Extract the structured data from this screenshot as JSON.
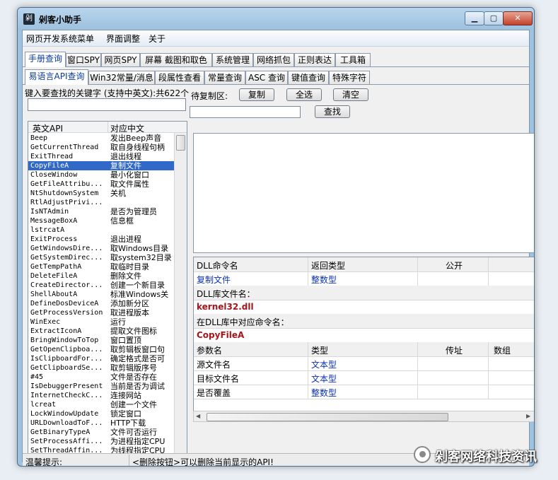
{
  "window": {
    "title": "剁客小助手",
    "min_glyph": "▁",
    "max_glyph": "▢",
    "close_glyph": "✕",
    "app_glyph": "剁"
  },
  "menu": [
    "网页开发系统菜单",
    "界面调整",
    "关于"
  ],
  "main_tabs": [
    {
      "label": "手册查询",
      "active": true
    },
    {
      "label": "窗口SPY",
      "active": false
    },
    {
      "label": "网页SPY",
      "active": false
    },
    {
      "label": "屏幕 截图和取色",
      "active": false
    },
    {
      "label": "系统管理",
      "active": false
    },
    {
      "label": "网络抓包",
      "active": false
    },
    {
      "label": "正则表达",
      "active": false
    },
    {
      "label": "工具箱",
      "active": false
    }
  ],
  "sub_tabs": [
    {
      "label": "易语言API查询",
      "active": true
    },
    {
      "label": "Win32常量/消息",
      "active": false
    },
    {
      "label": "段属性查看",
      "active": false
    },
    {
      "label": "常量查询",
      "active": false
    },
    {
      "label": "ASC 查询",
      "active": false
    },
    {
      "label": "键值查询",
      "active": false
    },
    {
      "label": "特殊字符",
      "active": false
    }
  ],
  "search": {
    "label": "键入要查找的关键字 (支持中英文):共622个",
    "value": ""
  },
  "copy_panel": {
    "label": "待复制区:",
    "copy_button": "复制",
    "select_all_button": "全选",
    "clear_button": "清空",
    "find_value": "",
    "find_button": "查找",
    "content": ""
  },
  "api_list": {
    "columns": [
      "英文API",
      "对应中文"
    ],
    "selected_index": 3,
    "rows": [
      [
        "Beep",
        "发出Beep声音"
      ],
      [
        "GetCurrentThread",
        "取自身线程句柄"
      ],
      [
        "ExitThread",
        "退出线程"
      ],
      [
        "CopyFileA",
        "复制文件"
      ],
      [
        "CloseWindow",
        "最小化窗口"
      ],
      [
        "GetFileAttribu...",
        "取文件属性"
      ],
      [
        "NtShutdownSystem",
        "关机"
      ],
      [
        "RtlAdjustPrivi...",
        ""
      ],
      [
        "IsNTAdmin",
        "是否为管理员"
      ],
      [
        "MessageBoxA",
        "信息框"
      ],
      [
        "lstrcatA",
        ""
      ],
      [
        "ExitProcess",
        "退出进程"
      ],
      [
        "GetWindowsDire...",
        "取Windows目录"
      ],
      [
        "GetSystemDirec...",
        "取system32目录"
      ],
      [
        "GetTempPathA",
        "取临时目录"
      ],
      [
        "DeleteFileA",
        "删除文件"
      ],
      [
        "CreateDirector...",
        "创建一个新目录"
      ],
      [
        "ShellAboutA",
        "标准Windows关"
      ],
      [
        "DefineDosDeviceA",
        "添加新分区"
      ],
      [
        "GetProcessVersion",
        "取进程版本"
      ],
      [
        "WinExec",
        "运行"
      ],
      [
        "ExtractIconA",
        "提取文件图标"
      ],
      [
        "BringWindowToTop",
        "窗口置顶"
      ],
      [
        "GetOpenClipboa...",
        "取剪辑板窗口句"
      ],
      [
        "IsClipboardFor...",
        "确定格式是否可"
      ],
      [
        "GetClipboardSe...",
        "取剪辑版序号"
      ],
      [
        "#45",
        "文件是否存在"
      ],
      [
        "IsDebuggerPresent",
        "当前是否为调试"
      ],
      [
        "InternetCheckC...",
        "连接网站"
      ],
      [
        "lcreat",
        "创建一个文件"
      ],
      [
        "LockWindowUpdate",
        "锁定窗口"
      ],
      [
        "URLDownloadToF...",
        "HTTP下载"
      ],
      [
        "GetBinaryTypeA",
        "文件可否运行"
      ],
      [
        "SetProcessAffi...",
        "为进程指定CPU"
      ],
      [
        "SetThreadAffin...",
        "为线程指定CPU"
      ]
    ]
  },
  "detail": {
    "dll_header": [
      "DLL命令名",
      "返回类型",
      "公开"
    ],
    "dll_row": [
      "复制文件",
      "整数型",
      ""
    ],
    "lib_label": "DLL库文件名：",
    "lib_value": "kernel32.dll",
    "cmd_label": "在DLL库中对应命令名：",
    "cmd_value": "CopyFileA",
    "param_header": [
      "参数名",
      "类型",
      "传址",
      "数组"
    ],
    "params": [
      [
        "源文件名",
        "文本型",
        "",
        ""
      ],
      [
        "目标文件名",
        "文本型",
        "",
        ""
      ],
      [
        "是否覆盖",
        "整数型",
        "",
        ""
      ]
    ]
  },
  "status": {
    "tip_label": "温馨提示:",
    "tip_text": "<删除按钮>可以删除当前显示的API!"
  },
  "watermark": {
    "text": "剁客网络科技资讯"
  }
}
